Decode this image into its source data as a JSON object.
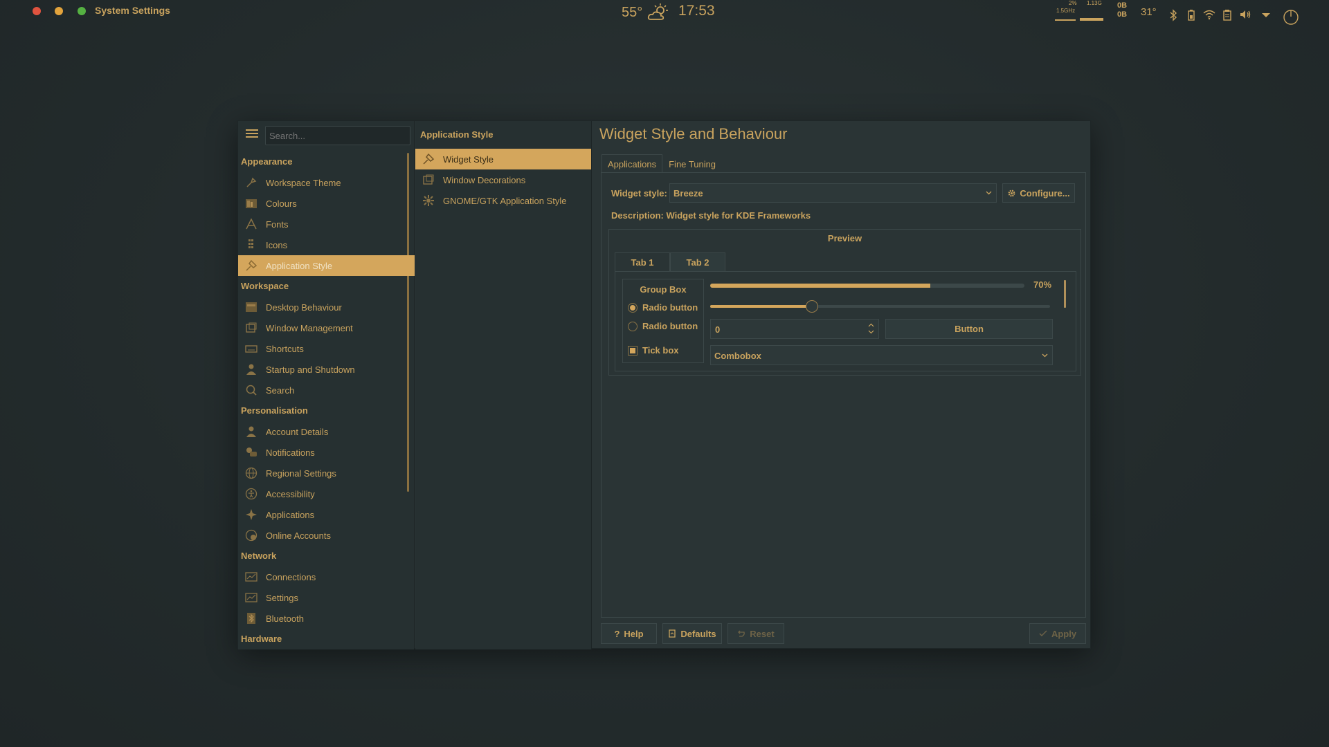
{
  "window": {
    "title": "System Settings"
  },
  "topbar": {
    "temperature": "55°",
    "weather_icon": "partly-cloudy-icon",
    "time": "17:53",
    "cpu_usage": "2%",
    "cpu_freq": "1.5GHz",
    "ram_usage": "1.13G",
    "net_up": "0B",
    "net_down": "0B",
    "cpu_temp": "31°",
    "tray_icons": [
      "bluetooth-icon",
      "battery-icon",
      "wifi-icon",
      "clipboard-icon",
      "volume-icon",
      "expand-icon",
      "power-icon"
    ]
  },
  "sidebar": {
    "search_placeholder": "Search...",
    "sections": [
      {
        "title": "Appearance",
        "items": [
          "Workspace Theme",
          "Colours",
          "Fonts",
          "Icons",
          "Application Style"
        ]
      },
      {
        "title": "Workspace",
        "items": [
          "Desktop Behaviour",
          "Window Management",
          "Shortcuts",
          "Startup and Shutdown",
          "Search"
        ]
      },
      {
        "title": "Personalisation",
        "items": [
          "Account Details",
          "Notifications",
          "Regional Settings",
          "Accessibility",
          "Applications",
          "Online Accounts"
        ]
      },
      {
        "title": "Network",
        "items": [
          "Connections",
          "Settings",
          "Bluetooth"
        ]
      },
      {
        "title": "Hardware",
        "items": []
      }
    ],
    "active_item": "Application Style"
  },
  "middle": {
    "header": "Application Style",
    "items": [
      "Widget Style",
      "Window Decorations",
      "GNOME/GTK Application Style"
    ],
    "active_item": "Widget Style"
  },
  "main": {
    "title": "Widget Style and Behaviour",
    "tabs": [
      "Applications",
      "Fine Tuning"
    ],
    "widget_style_label": "Widget style:",
    "widget_style_value": "Breeze",
    "configure_label": "Configure...",
    "description": "Description: Widget style for KDE Frameworks",
    "preview": {
      "title": "Preview",
      "tabs": [
        "Tab 1",
        "Tab 2"
      ],
      "group_box_title": "Group Box",
      "radio_1": "Radio button",
      "radio_2": "Radio button",
      "tick_box": "Tick box",
      "progress_value": 0.7,
      "progress_label": "70%",
      "slider_value": 0.3,
      "spin_value": "0",
      "button_label": "Button",
      "combobox_value": "Combobox"
    },
    "footer": {
      "help": "Help",
      "defaults": "Defaults",
      "reset": "Reset",
      "apply": "Apply"
    }
  },
  "colors": {
    "accent": "#d4a65c",
    "text": "#c9a35e",
    "background": "#2a3435"
  }
}
